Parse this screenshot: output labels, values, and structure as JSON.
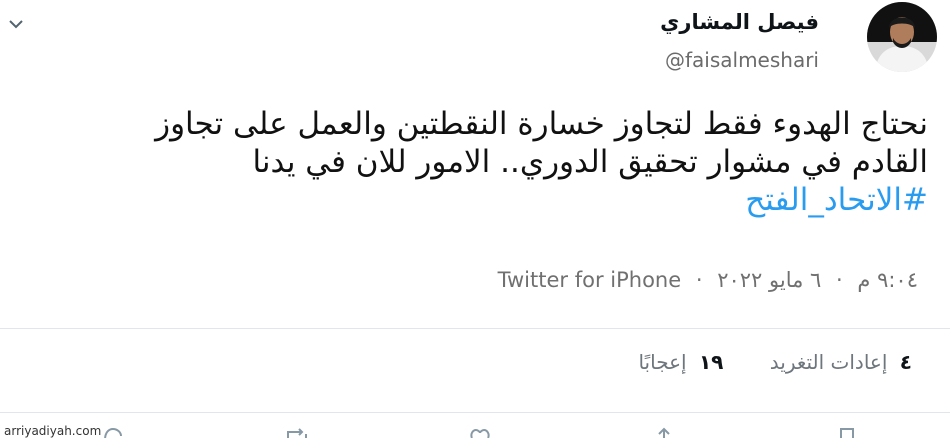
{
  "header": {
    "display_name": "فيصل المشاري",
    "handle": "@faisalmeshari",
    "avatar_icon": "profile-photo",
    "more_icon": "chevron-down-icon"
  },
  "tweet": {
    "line1": "نحتاج الهدوء فقط لتجاوز خسارة النقطتين والعمل على تجاوز",
    "line2": "القادم في مشوار تحقيق الدوري.. الامور للان في يدنا",
    "hashtag": "#الاتحاد_الفتح",
    "hashtag_color": "#2a9cf0"
  },
  "meta": {
    "time": "٩:٠٤ م",
    "date": "٦ مايو ٢٠٢٢",
    "source": "Twitter for iPhone",
    "separator": "·"
  },
  "stats": {
    "retweets_count": "٤",
    "retweets_label": "إعادات التغريد",
    "likes_count": "١٩",
    "likes_label": "إعجابًا"
  },
  "actions": [
    {
      "icon": "reply-icon"
    },
    {
      "icon": "retweet-icon"
    },
    {
      "icon": "like-icon"
    },
    {
      "icon": "share-icon"
    },
    {
      "icon": "bookmark-icon"
    }
  ],
  "watermark": "arriyadiyah.com"
}
